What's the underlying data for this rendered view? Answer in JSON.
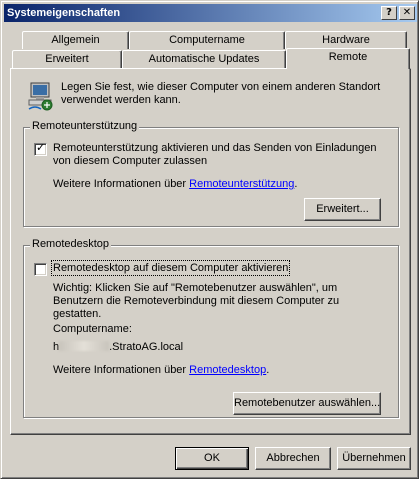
{
  "window": {
    "title": "Systemeigenschaften",
    "help_btn": "?",
    "close_btn": "✕"
  },
  "tabs_back": [
    "Allgemein",
    "Computername",
    "Hardware"
  ],
  "tabs_front": [
    "Erweitert",
    "Automatische Updates",
    "Remote"
  ],
  "active_tab": "Remote",
  "intro": "Legen Sie fest, wie dieser Computer von einem anderen Standort verwendet werden kann.",
  "remote_assist": {
    "label": "Remoteunterstützung",
    "checkbox_text": "Remoteunterstützung aktivieren und das Senden von Einladungen von diesem Computer zulassen",
    "checked": true,
    "info_prefix": "Weitere Informationen über ",
    "info_link": "Remoteunterstützung",
    "info_suffix": ".",
    "advanced_button": "Erweitert..."
  },
  "remote_desktop": {
    "label": "Remotedesktop",
    "checkbox_text": "Remotedesktop auf diesem Computer aktivieren",
    "checked": false,
    "note": "Wichtig: Klicken Sie auf \"Remotebenutzer auswählen\", um Benutzern die Remoteverbindung mit diesem Computer zu gestatten.",
    "computer_name_label": "Computername:",
    "computer_name_prefix": "h",
    "computer_name_suffix": ".StratoAG.local",
    "info_prefix": "Weitere Informationen über ",
    "info_link": "Remotedesktop",
    "info_suffix": ".",
    "select_users_button": "Remotebenutzer auswählen..."
  },
  "footer": {
    "ok": "OK",
    "cancel": "Abbrechen",
    "apply": "Übernehmen"
  }
}
